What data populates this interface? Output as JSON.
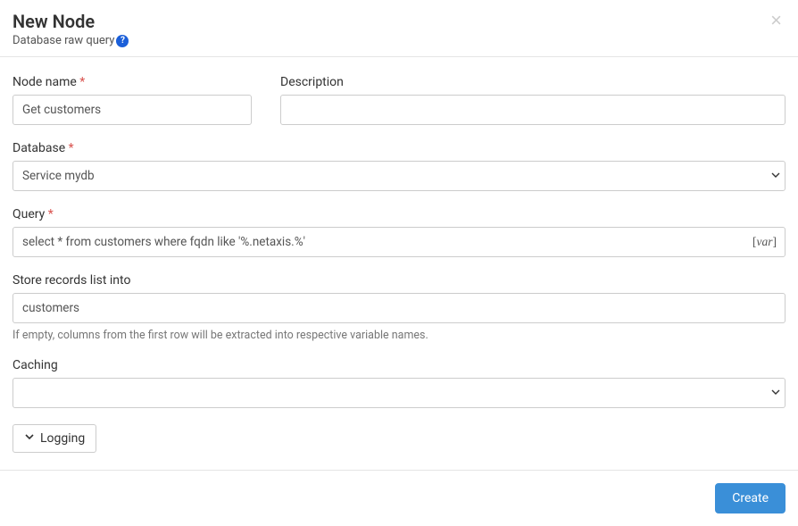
{
  "header": {
    "title": "New Node",
    "subtitle": "Database raw query"
  },
  "form": {
    "node_name": {
      "label": "Node name",
      "value": "Get customers"
    },
    "description": {
      "label": "Description",
      "value": ""
    },
    "database": {
      "label": "Database",
      "selected": "Service mydb"
    },
    "query": {
      "label": "Query",
      "value": "select * from customers where fqdn like '%.netaxis.%'",
      "var_hint": "var"
    },
    "store": {
      "label": "Store records list into",
      "value": "customers",
      "help": "If empty, columns from the first row will be extracted into respective variable names."
    },
    "caching": {
      "label": "Caching",
      "selected": ""
    },
    "logging": {
      "label": "Logging"
    }
  },
  "footer": {
    "create": "Create"
  }
}
